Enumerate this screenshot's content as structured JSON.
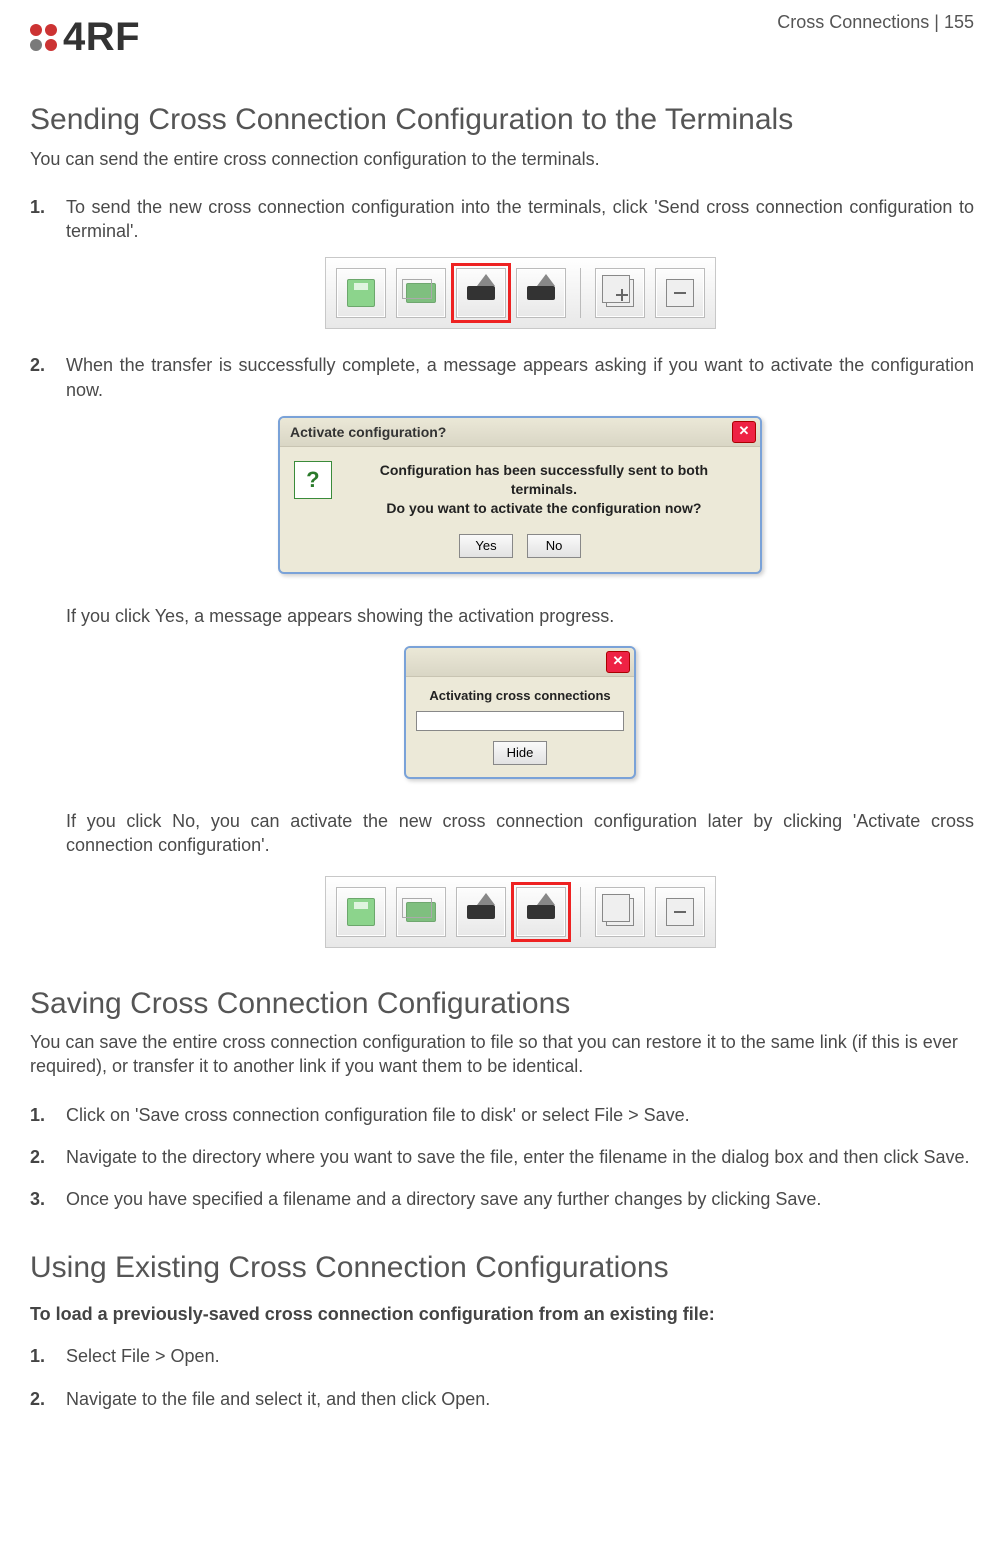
{
  "header": {
    "brand": "4RF",
    "page_meta": "Cross Connections  |  155"
  },
  "section1": {
    "title": "Sending Cross Connection Configuration to the Terminals",
    "intro": "You can send the entire cross connection configuration to the terminals.",
    "step1": "To send the new cross connection configuration into the terminals, click 'Send cross connection configuration to terminal'.",
    "step2": "When the transfer is successfully complete, a message appears asking if you want to activate the configuration now.",
    "after_yes": "If you click Yes, a message appears showing the activation progress.",
    "after_no": "If you click No, you can activate the new cross connection configuration later by clicking 'Activate cross connection configuration'."
  },
  "dialog_confirm": {
    "title": "Activate configuration?",
    "line1": "Configuration has been successfully sent to both terminals.",
    "line2": "Do you want to activate the configuration now?",
    "yes": "Yes",
    "no": "No"
  },
  "dialog_progress": {
    "status": "Activating cross connections",
    "hide": "Hide"
  },
  "section2": {
    "title": "Saving Cross Connection Configurations",
    "intro": "You can save the entire cross connection configuration to file so that you can restore it to the same link (if this is ever required), or transfer it to another link if you want them to be identical.",
    "step1": "Click on 'Save cross connection configuration file to disk' or select File > Save.",
    "step2": "Navigate to the directory where you want to save the file, enter the filename in the dialog box and then click Save.",
    "step3": "Once you have specified a filename and a directory save any further changes by clicking Save."
  },
  "section3": {
    "title": "Using Existing Cross Connection Configurations",
    "lead": "To load a previously-saved cross connection configuration from an existing file:",
    "step1": "Select File > Open.",
    "step2": "Navigate to the file and select it, and then click Open."
  }
}
